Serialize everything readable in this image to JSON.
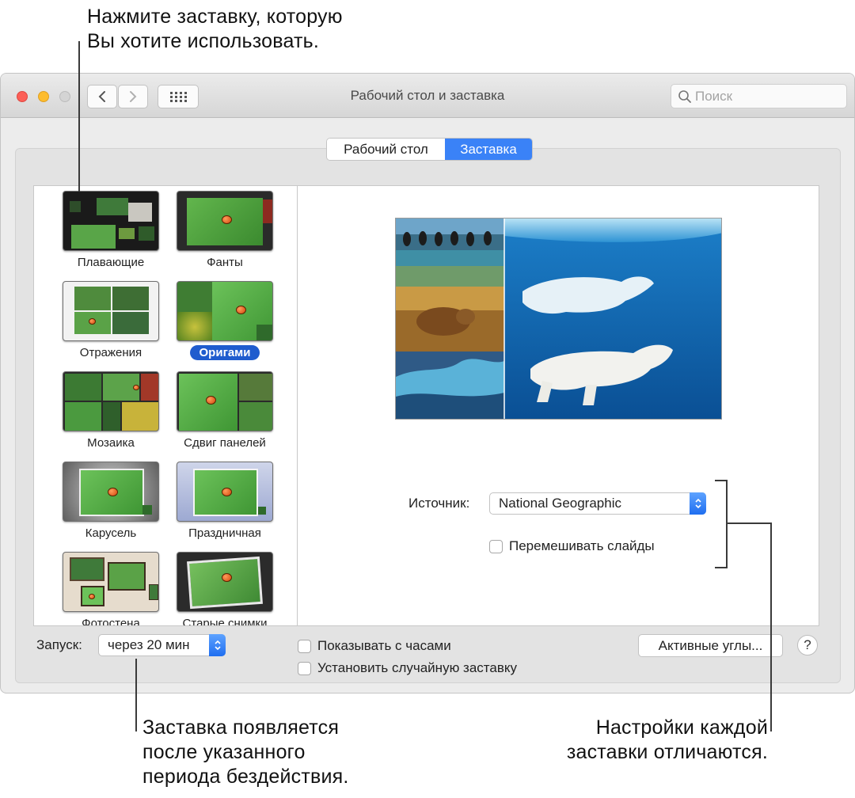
{
  "callouts": {
    "top_line1": "Нажмите заставку, которую",
    "top_line2": "Вы хотите использовать.",
    "bottom_left_line1": "Заставка появляется",
    "bottom_left_line2": "после указанного",
    "bottom_left_line3": "периода бездействия.",
    "bottom_right_line1": "Настройки каждой",
    "bottom_right_line2": "заставки отличаются."
  },
  "window": {
    "title": "Рабочий стол и заставка",
    "search_placeholder": "Поиск"
  },
  "tabs": {
    "desktop": "Рабочий стол",
    "screensaver": "Заставка",
    "selected": "Заставка"
  },
  "screensavers": [
    {
      "label": "Плавающие"
    },
    {
      "label": "Фанты"
    },
    {
      "label": "Отражения"
    },
    {
      "label": "Оригами"
    },
    {
      "label": "Мозаика"
    },
    {
      "label": "Сдвиг панелей"
    },
    {
      "label": "Карусель"
    },
    {
      "label": "Праздничная"
    },
    {
      "label": "Фотостена"
    },
    {
      "label": "Старые снимки"
    }
  ],
  "selected_screensaver": "Оригами",
  "options": {
    "source_label": "Источник:",
    "source_value": "National Geographic",
    "shuffle_label": "Перемешивать слайды",
    "shuffle_checked": false
  },
  "footer": {
    "start_label": "Запуск:",
    "start_value": "через 20 мин",
    "show_clock_label": "Показывать с часами",
    "show_clock_checked": false,
    "random_label": "Установить случайную заставку",
    "random_checked": false,
    "hot_corners_label": "Активные углы...",
    "help_label": "?"
  }
}
